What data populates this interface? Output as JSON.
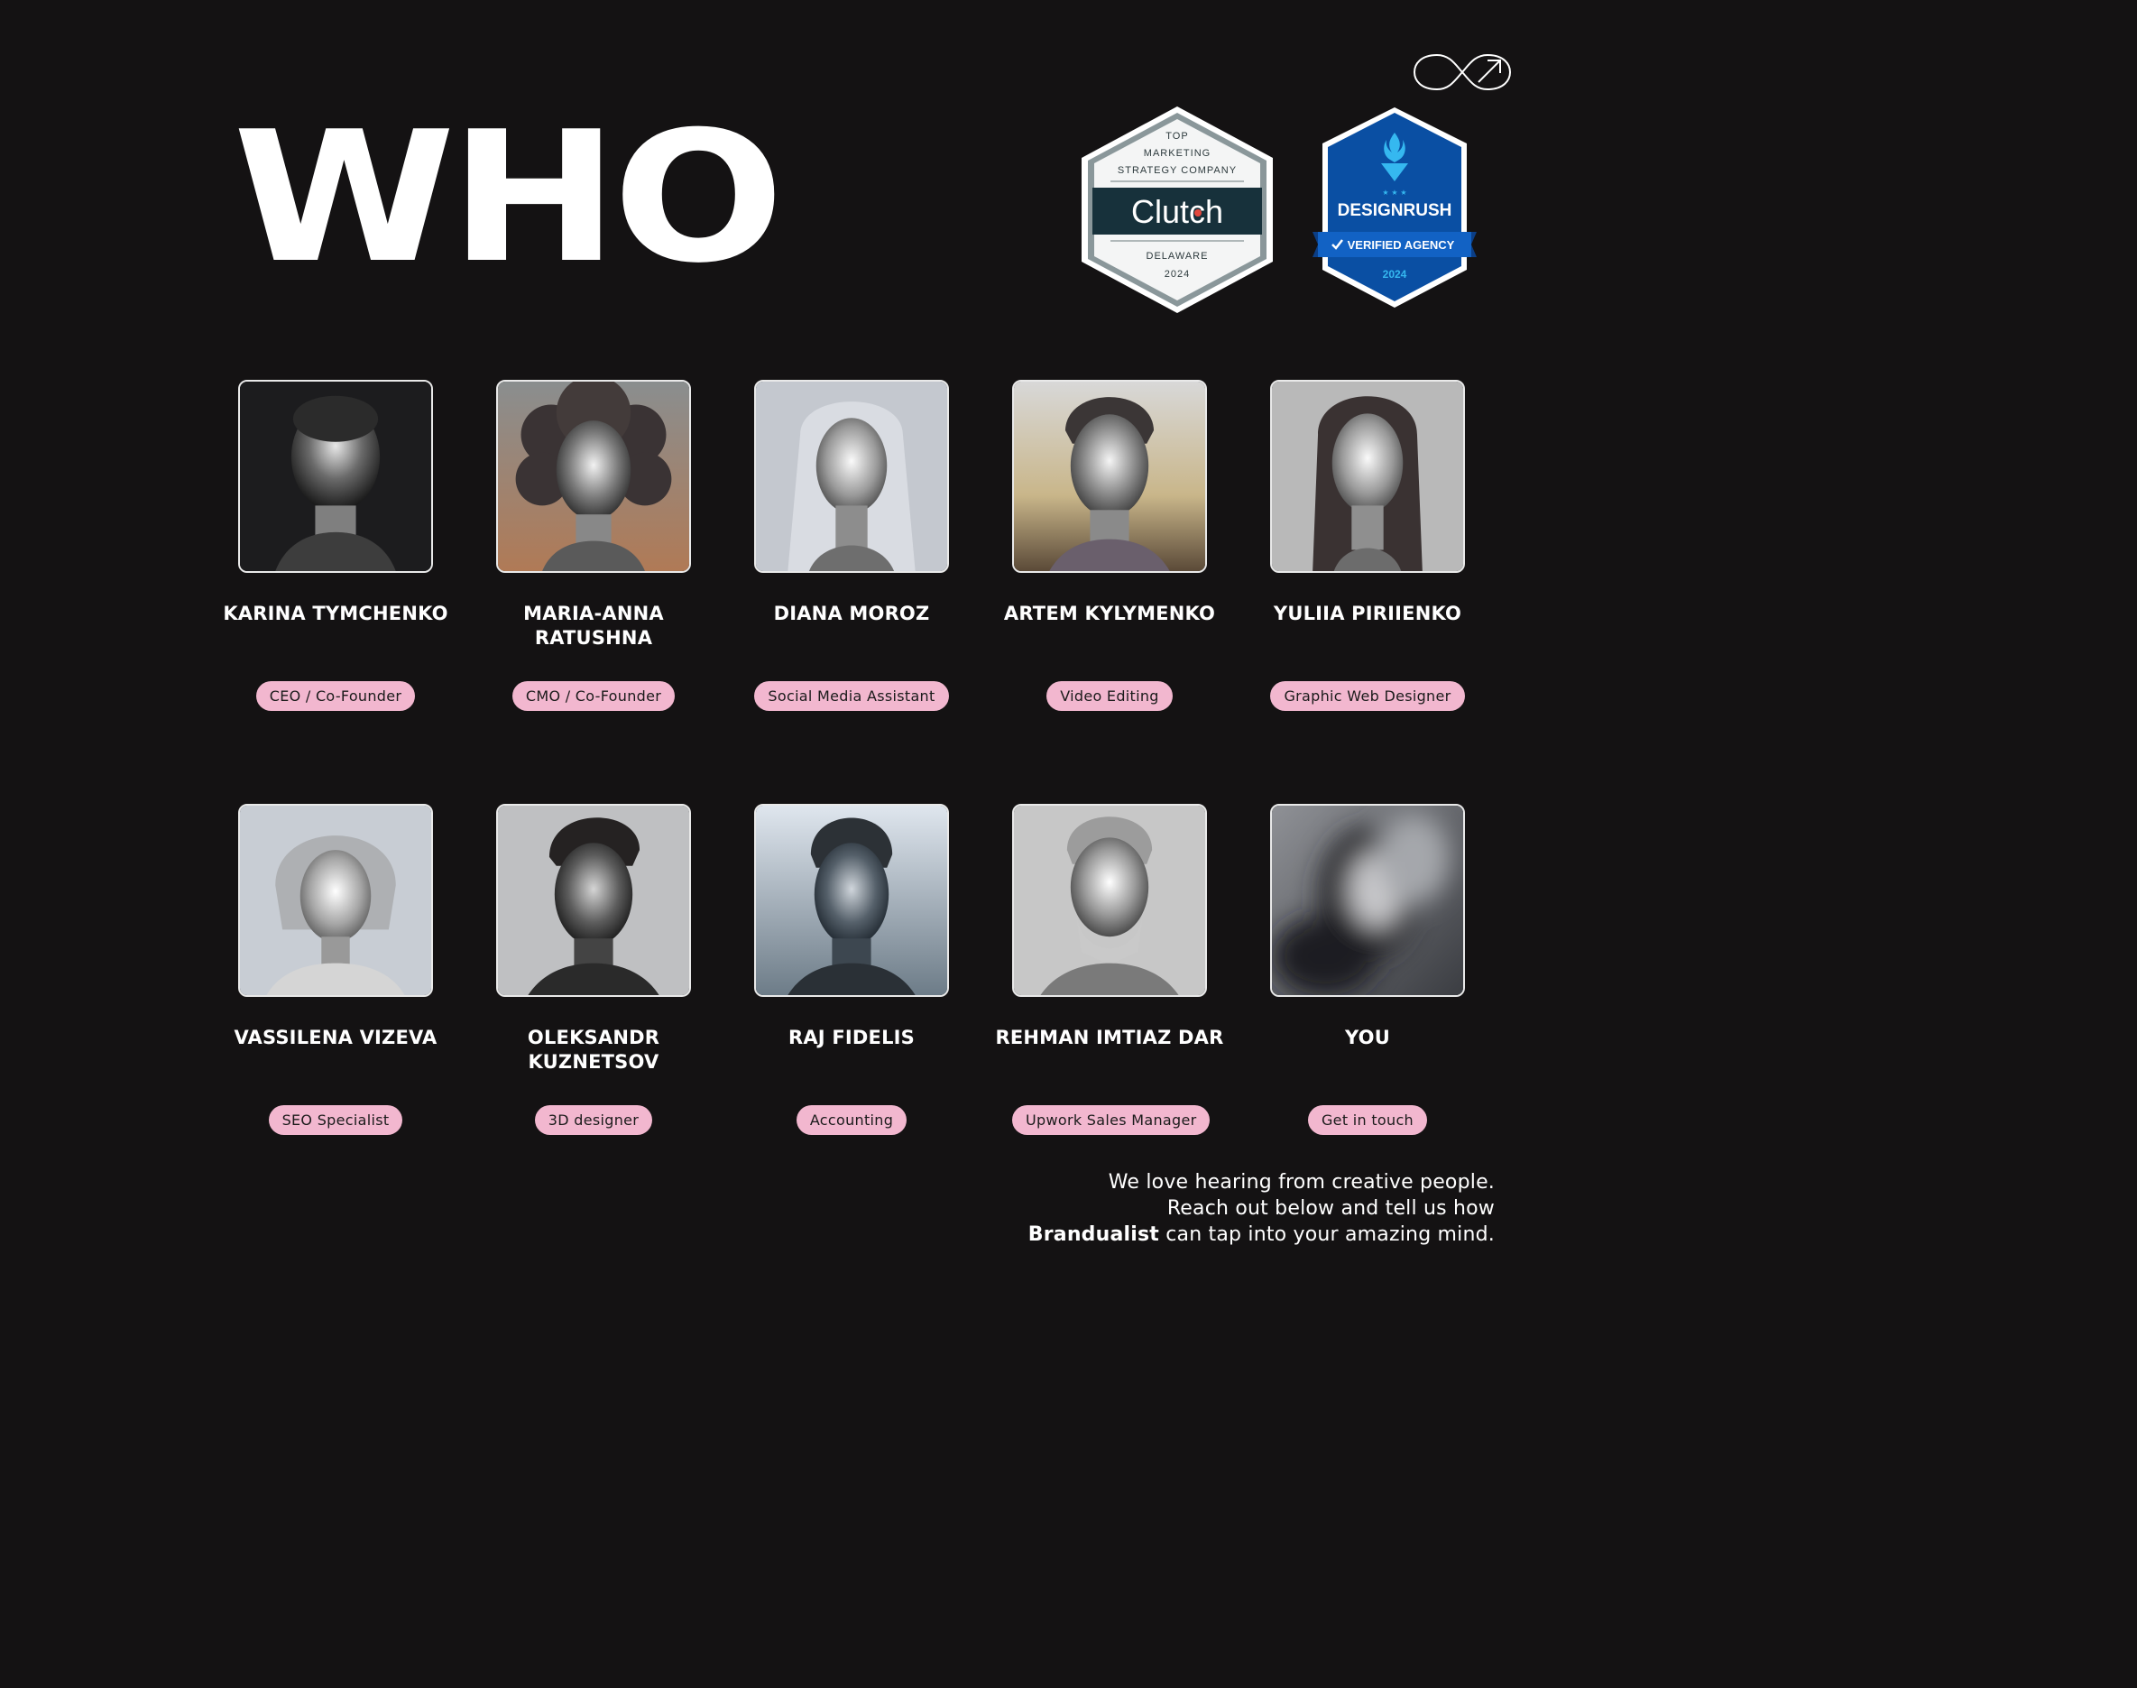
{
  "header": {
    "title": "WHO",
    "logo_icon": "infinity-arrow-icon"
  },
  "badges": {
    "clutch": {
      "line1": "TOP",
      "line2": "MARKETING",
      "line3": "STRATEGY COMPANY",
      "name": "Clutch",
      "location": "DELAWARE",
      "year": "2024"
    },
    "designrush": {
      "name": "DESIGNRUSH",
      "ribbon": "VERIFIED AGENCY",
      "year": "2024"
    }
  },
  "team": [
    {
      "name": "KARINA TYMCHENKO",
      "role": "CEO / Co-Founder"
    },
    {
      "name": "MARIA-ANNA RATUSHNA",
      "role": "CMO / Co-Founder"
    },
    {
      "name": "DIANA MOROZ",
      "role": "Social Media Assistant"
    },
    {
      "name": "ARTEM KYLYMENKO",
      "role": "Video Editing"
    },
    {
      "name": "YULIIA PIRIIENKO",
      "role": "Graphic Web Designer"
    },
    {
      "name": "VASSILENA VIZEVA",
      "role": "SEO Specialist"
    },
    {
      "name": "OLEKSANDR KUZNETSOV",
      "role": "3D designer"
    },
    {
      "name": "RAJ FIDELIS",
      "role": "Accounting"
    },
    {
      "name": "REHMAN IMTIAZ DAR",
      "role": "Upwork Sales Manager"
    },
    {
      "name": "YOU",
      "role": "Get in touch"
    }
  ],
  "blurb": {
    "line1": "We love hearing from creative people.",
    "line2": "Reach out below and tell us how",
    "brand": "Brandualist",
    "line3_rest": " can tap into your amazing mind."
  },
  "colors": {
    "background": "#141213",
    "pill": "#f2b7cf",
    "clutch_dark": "#17313b",
    "designrush_blue": "#0a4fa3"
  }
}
